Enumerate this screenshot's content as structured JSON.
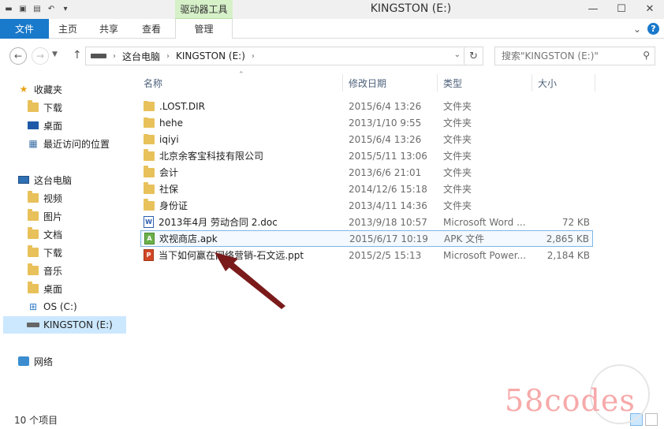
{
  "titlebar": {
    "title": "KINGSTON (E:)",
    "context_tab": "驱动器工具",
    "qat_icons": [
      "drive-icon",
      "properties-icon",
      "new-folder-icon",
      "undo-icon",
      "customize-icon"
    ],
    "minimize": "—",
    "maximize": "☐",
    "close": "✕"
  },
  "ribbon": {
    "tabs": [
      {
        "label": "文件",
        "color": "#1979ca"
      },
      {
        "label": "主页"
      },
      {
        "label": "共享"
      },
      {
        "label": "查看"
      },
      {
        "label": "管理"
      }
    ],
    "collapse": "⌄",
    "help": "?"
  },
  "address": {
    "crumbs": [
      "这台电脑",
      "KINGSTON (E:)"
    ],
    "search_placeholder": "搜索\"KINGSTON (E:)\""
  },
  "navpane": {
    "favorites_label": "收藏夹",
    "favorites": [
      "下载",
      "桌面",
      "最近访问的位置"
    ],
    "pc_label": "这台电脑",
    "pc_items": [
      "视频",
      "图片",
      "文档",
      "下载",
      "音乐",
      "桌面",
      "OS (C:)",
      "KINGSTON (E:)"
    ],
    "network_label": "网络"
  },
  "columns": {
    "name": "名称",
    "date": "修改日期",
    "type": "类型",
    "size": "大小"
  },
  "files": [
    {
      "name": ".LOST.DIR",
      "date": "2015/6/4 13:26",
      "type": "文件夹",
      "size": "",
      "icon": "folder-icon"
    },
    {
      "name": "hehe",
      "date": "2013/1/10 9:55",
      "type": "文件夹",
      "size": "",
      "icon": "folder-icon"
    },
    {
      "name": "iqiyi",
      "date": "2015/6/4 13:26",
      "type": "文件夹",
      "size": "",
      "icon": "folder-icon"
    },
    {
      "name": "北京余客宝科技有限公司",
      "date": "2015/5/11 13:06",
      "type": "文件夹",
      "size": "",
      "icon": "folder-icon"
    },
    {
      "name": "会计",
      "date": "2013/6/6 21:01",
      "type": "文件夹",
      "size": "",
      "icon": "folder-icon"
    },
    {
      "name": "社保",
      "date": "2014/12/6 15:18",
      "type": "文件夹",
      "size": "",
      "icon": "folder-icon"
    },
    {
      "name": "身份证",
      "date": "2013/4/11 14:36",
      "type": "文件夹",
      "size": "",
      "icon": "folder-icon"
    },
    {
      "name": "2013年4月 劳动合同 2.doc",
      "date": "2013/9/18 10:57",
      "type": "Microsoft Word ...",
      "size": "72 KB",
      "icon": "word-doc-icon"
    },
    {
      "name": "欢视商店.apk",
      "date": "2015/6/17 10:19",
      "type": "APK 文件",
      "size": "2,865 KB",
      "icon": "apk-icon"
    },
    {
      "name": "当下如何赢在网络营销-石文远.ppt",
      "date": "2015/2/5 15:13",
      "type": "Microsoft Power...",
      "size": "2,184 KB",
      "icon": "ppt-icon"
    }
  ],
  "highlight_color": "#7fb6e6",
  "arrow_color": "#7a1a1a",
  "status": {
    "count": "10 个项目"
  },
  "watermark": "58codes"
}
